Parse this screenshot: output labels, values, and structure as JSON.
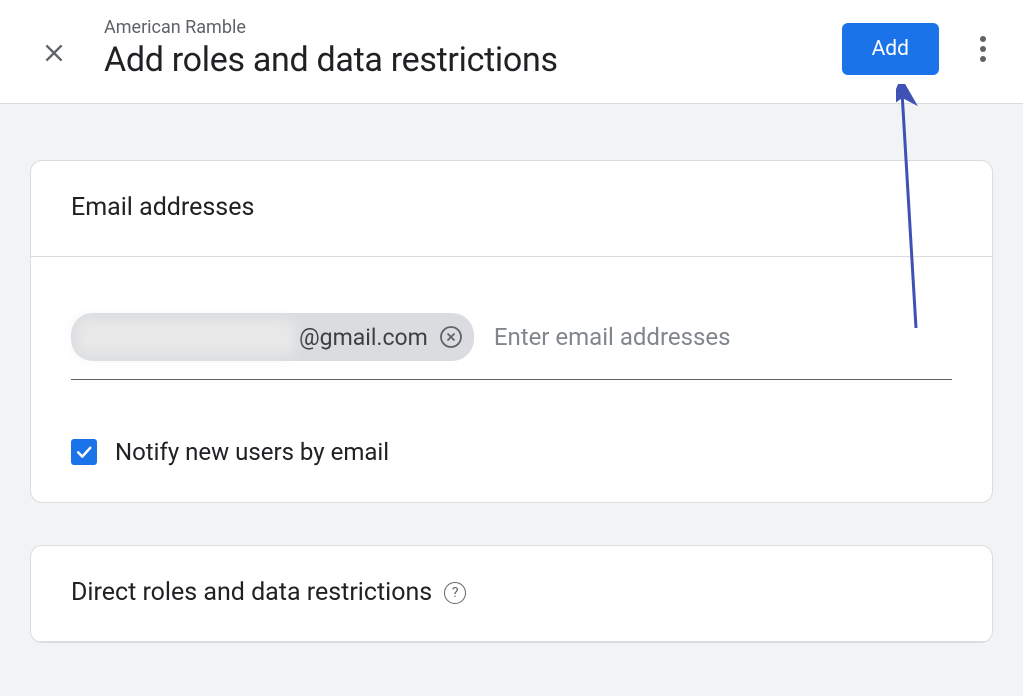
{
  "header": {
    "breadcrumb": "American Ramble",
    "title": "Add roles and data restrictions",
    "add_button_label": "Add"
  },
  "email_card": {
    "title": "Email addresses",
    "chip_domain": "@gmail.com",
    "input_placeholder": "Enter email addresses",
    "notify_checkbox_label": "Notify new users by email",
    "notify_checked": true
  },
  "roles_card": {
    "title": "Direct roles and data restrictions"
  },
  "annotation": {
    "arrow_color": "#3f51b5"
  }
}
